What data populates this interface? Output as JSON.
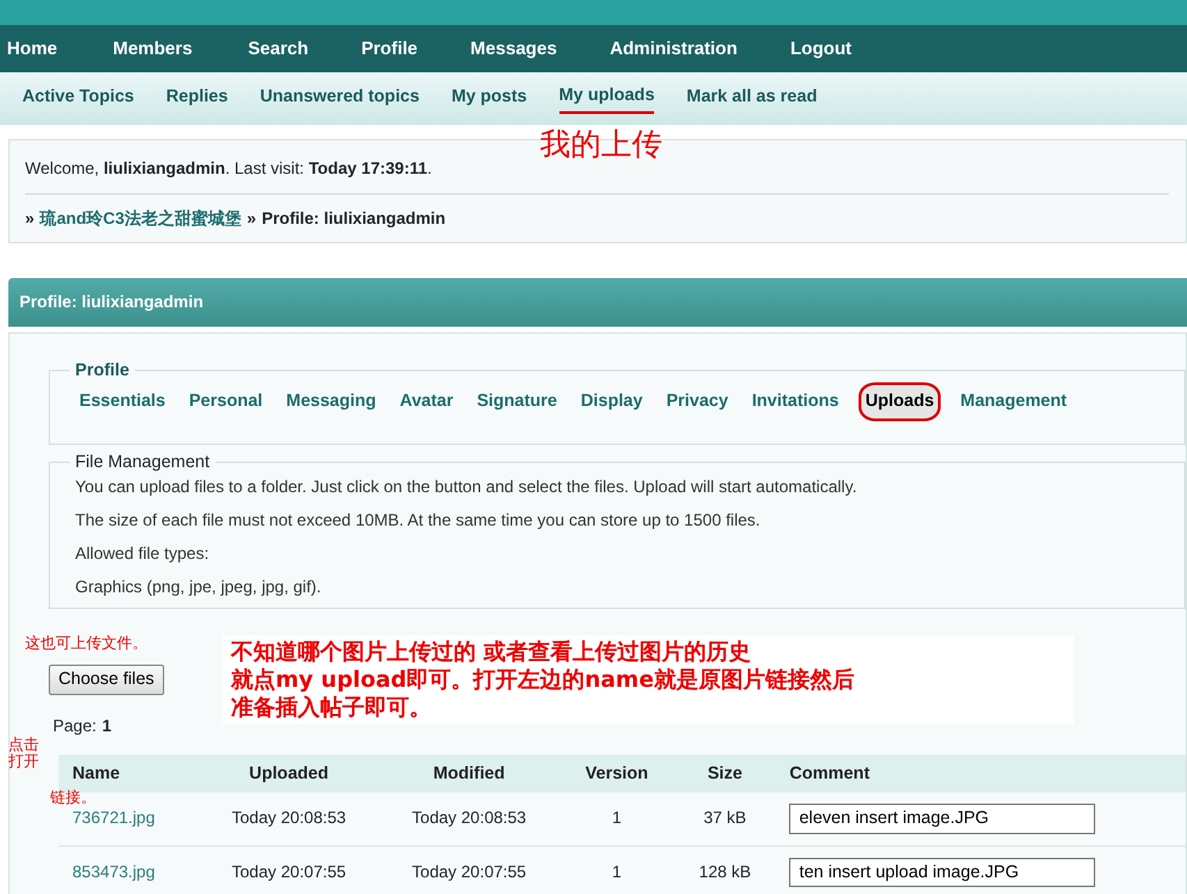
{
  "main_nav": [
    {
      "label": "Home"
    },
    {
      "label": "Members"
    },
    {
      "label": "Search"
    },
    {
      "label": "Profile"
    },
    {
      "label": "Messages"
    },
    {
      "label": "Administration"
    },
    {
      "label": "Logout"
    }
  ],
  "sub_nav": [
    {
      "label": "Active Topics",
      "selected": false
    },
    {
      "label": "Replies",
      "selected": false
    },
    {
      "label": "Unanswered topics",
      "selected": false
    },
    {
      "label": "My posts",
      "selected": false
    },
    {
      "label": "My uploads",
      "selected": true
    },
    {
      "label": "Mark all as read",
      "selected": false
    }
  ],
  "welcome": {
    "text": "Welcome, **liulixiangadmin**.  Last visit: **Today 17:39:11**."
  },
  "breadcrumb": [
    {
      "label": "»",
      "kind": "separator"
    },
    {
      "label": "琉and玲C3法老之甜蜜城堡",
      "kind": "link"
    },
    {
      "label": "»",
      "kind": "separator"
    },
    {
      "label": "Profile: liulixiangadmin",
      "kind": "current"
    }
  ],
  "panel_title": "Profile: liulixiangadmin",
  "profile_tabs": {
    "legend": "Profile",
    "tabs": [
      {
        "label": "Essentials",
        "selected": false
      },
      {
        "label": "Personal",
        "selected": false
      },
      {
        "label": "Messaging",
        "selected": false
      },
      {
        "label": "Avatar",
        "selected": false
      },
      {
        "label": "Signature",
        "selected": false
      },
      {
        "label": "Display",
        "selected": false
      },
      {
        "label": "Privacy",
        "selected": false
      },
      {
        "label": "Invitations",
        "selected": false
      },
      {
        "label": "Uploads",
        "selected": true
      },
      {
        "label": "Management",
        "selected": false
      }
    ]
  },
  "file_management": {
    "legend": "File Management",
    "lines": [
      "You can upload files to a folder. Just click on the button and select the files. Upload will start automatically.",
      "The size of each file must not exceed 10MB. At the same time you can store up to 1500 files.",
      "Allowed file types:",
      "Graphics (png, jpe, jpeg, jpg, gif)."
    ],
    "button": "Choose files",
    "page_label": "Page:",
    "page": "1"
  },
  "table": {
    "columns": [
      "Name",
      "Uploaded",
      "Modified",
      "Version",
      "Size",
      "Comment"
    ],
    "rows": [
      {
        "name": "736721.jpg",
        "uploaded": "Today 20:08:53",
        "modified": "Today 20:08:53",
        "version": "1",
        "size": "37 kB",
        "comment": "eleven insert image.JPG"
      },
      {
        "name": "853473.jpg",
        "uploaded": "Today 20:07:55",
        "modified": "Today 20:07:55",
        "version": "1",
        "size": "128 kB",
        "comment": "ten insert upload image.JPG"
      }
    ]
  },
  "annotations": [
    {
      "kind": "nav",
      "text": "我的上传"
    },
    {
      "kind": "button",
      "text": "这也可上传文件。"
    },
    {
      "kind": "note",
      "lines": [
        "不知道哪个图片上传过的 或者查看上传过图片的历史",
        "就点my upload即可。打开左边的name就是原图片链接然后",
        "准备插入帖子即可。"
      ]
    },
    {
      "kind": "side",
      "lines": [
        "点击",
        "打开"
      ]
    },
    {
      "kind": "link",
      "text": "链接。"
    }
  ]
}
